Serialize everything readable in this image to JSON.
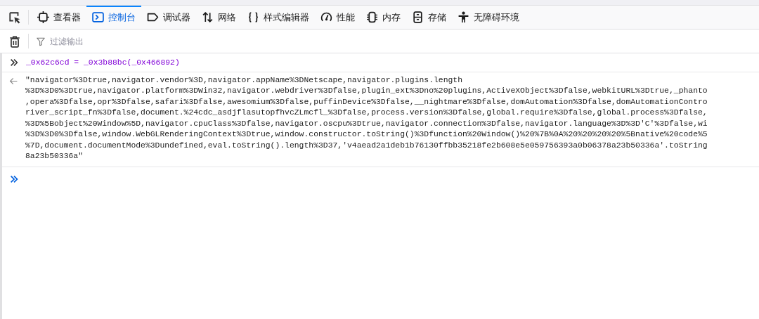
{
  "toolbar": {
    "tabs": [
      {
        "label": "查看器",
        "selected": false
      },
      {
        "label": "控制台",
        "selected": true
      },
      {
        "label": "调试器",
        "selected": false
      },
      {
        "label": "网络",
        "selected": false
      },
      {
        "label": "样式编辑器",
        "selected": false
      },
      {
        "label": "性能",
        "selected": false
      },
      {
        "label": "内存",
        "selected": false
      },
      {
        "label": "存储",
        "selected": false
      },
      {
        "label": "无障碍环境",
        "selected": false
      }
    ]
  },
  "filter": {
    "placeholder": "过滤输出"
  },
  "console": {
    "input": "_0x62c6cd = _0x3b88bc(_0x466892)",
    "output_lines": [
      "\"navigator%3Dtrue,navigator.vendor%3D,navigator.appName%3DNetscape,navigator.plugins.length",
      "%3D%3D0%3Dtrue,navigator.platform%3DWin32,navigator.webdriver%3Dfalse,plugin_ext%3Dno%20plugins,ActiveXObject%3Dfalse,webkitURL%3Dtrue,_phanto",
      ",opera%3Dfalse,opr%3Dfalse,safari%3Dfalse,awesomium%3Dfalse,puffinDevice%3Dfalse,__nightmare%3Dfalse,domAutomation%3Dfalse,domAutomationContro",
      "river_script_fn%3Dfalse,document.%24cdc_asdjflasutopfhvcZLmcfl_%3Dfalse,process.version%3Dfalse,global.require%3Dfalse,global.process%3Dfalse,",
      "%3D%5Bobject%20Window%5D,navigator.cpuClass%3Dfalse,navigator.oscpu%3Dtrue,navigator.connection%3Dfalse,navigator.language%3D%3D'C'%3Dfalse,wi",
      "%3D%3D0%3Dfalse,window.WebGLRenderingContext%3Dtrue,window.constructor.toString()%3Dfunction%20Window()%20%7B%0A%20%20%20%20%5Bnative%20code%5",
      "%7D,document.documentMode%3Dundefined,eval.toString().length%3D37,'v4aead2a1deb1b76130ffbb35218fe2b608e5e059756393a0b06378a23b50336a'.toString",
      "8a23b50336a\""
    ]
  }
}
